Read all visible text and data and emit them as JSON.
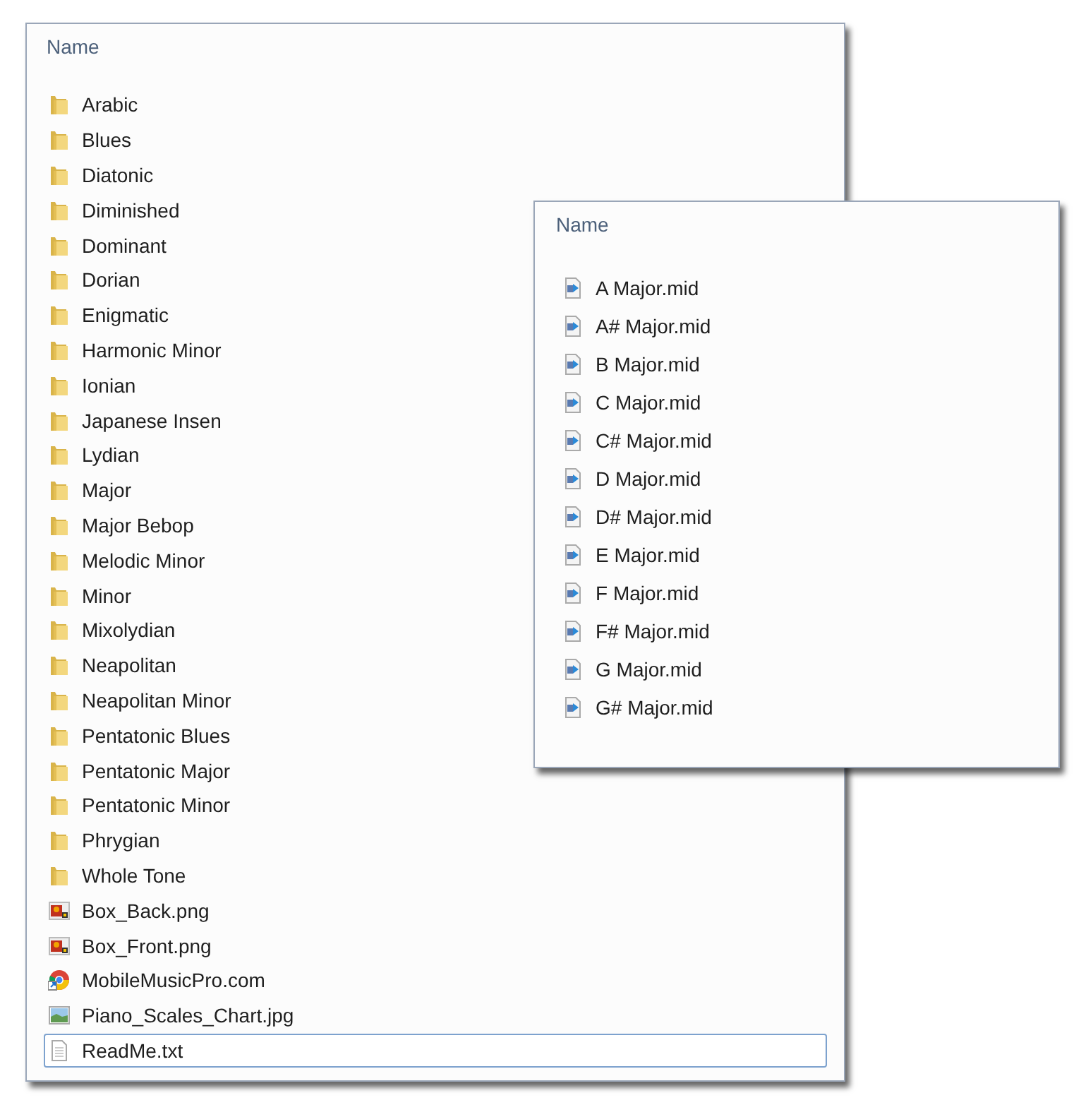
{
  "windows": [
    {
      "header": "Name",
      "items": [
        {
          "name": "Arabic",
          "kind": "folder",
          "selected": false
        },
        {
          "name": "Blues",
          "kind": "folder",
          "selected": false
        },
        {
          "name": "Diatonic",
          "kind": "folder",
          "selected": false
        },
        {
          "name": "Diminished",
          "kind": "folder",
          "selected": false
        },
        {
          "name": "Dominant",
          "kind": "folder",
          "selected": false
        },
        {
          "name": "Dorian",
          "kind": "folder",
          "selected": false
        },
        {
          "name": "Enigmatic",
          "kind": "folder",
          "selected": false
        },
        {
          "name": "Harmonic Minor",
          "kind": "folder",
          "selected": false
        },
        {
          "name": "Ionian",
          "kind": "folder",
          "selected": false
        },
        {
          "name": "Japanese Insen",
          "kind": "folder",
          "selected": false
        },
        {
          "name": "Lydian",
          "kind": "folder",
          "selected": false
        },
        {
          "name": "Major",
          "kind": "folder",
          "selected": false
        },
        {
          "name": "Major Bebop",
          "kind": "folder",
          "selected": false
        },
        {
          "name": "Melodic Minor",
          "kind": "folder",
          "selected": false
        },
        {
          "name": "Minor",
          "kind": "folder",
          "selected": false
        },
        {
          "name": "Mixolydian",
          "kind": "folder",
          "selected": false
        },
        {
          "name": "Neapolitan",
          "kind": "folder",
          "selected": false
        },
        {
          "name": "Neapolitan Minor",
          "kind": "folder",
          "selected": false
        },
        {
          "name": "Pentatonic Blues",
          "kind": "folder",
          "selected": false
        },
        {
          "name": "Pentatonic Major",
          "kind": "folder",
          "selected": false
        },
        {
          "name": "Pentatonic Minor",
          "kind": "folder",
          "selected": false
        },
        {
          "name": "Phrygian",
          "kind": "folder",
          "selected": false
        },
        {
          "name": "Whole Tone",
          "kind": "folder",
          "selected": false
        },
        {
          "name": "Box_Back.png",
          "kind": "image",
          "selected": false
        },
        {
          "name": "Box_Front.png",
          "kind": "image",
          "selected": false
        },
        {
          "name": "MobileMusicPro.com",
          "kind": "web",
          "selected": false
        },
        {
          "name": "Piano_Scales_Chart.jpg",
          "kind": "photo",
          "selected": false
        },
        {
          "name": "ReadMe.txt",
          "kind": "text",
          "selected": true
        }
      ]
    },
    {
      "header": "Name",
      "items": [
        {
          "name": "A Major.mid",
          "kind": "midi",
          "selected": false
        },
        {
          "name": "A# Major.mid",
          "kind": "midi",
          "selected": false
        },
        {
          "name": "B Major.mid",
          "kind": "midi",
          "selected": false
        },
        {
          "name": "C Major.mid",
          "kind": "midi",
          "selected": false
        },
        {
          "name": "C# Major.mid",
          "kind": "midi",
          "selected": false
        },
        {
          "name": "D Major.mid",
          "kind": "midi",
          "selected": false
        },
        {
          "name": "D# Major.mid",
          "kind": "midi",
          "selected": false
        },
        {
          "name": "E Major.mid",
          "kind": "midi",
          "selected": false
        },
        {
          "name": "F Major.mid",
          "kind": "midi",
          "selected": false
        },
        {
          "name": "F# Major.mid",
          "kind": "midi",
          "selected": false
        },
        {
          "name": "G Major.mid",
          "kind": "midi",
          "selected": false
        },
        {
          "name": "G# Major.mid",
          "kind": "midi",
          "selected": false
        }
      ]
    }
  ]
}
